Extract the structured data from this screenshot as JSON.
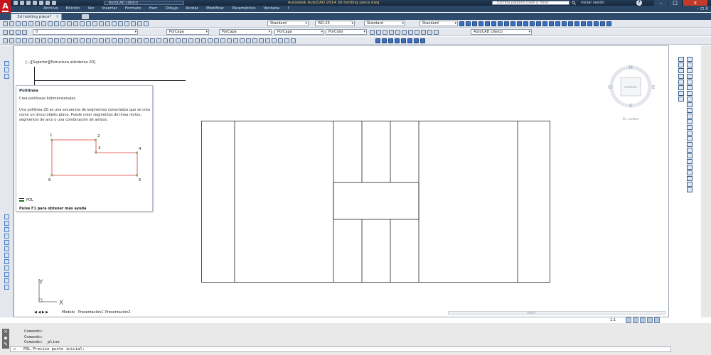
{
  "titlebar": {
    "workspace": "AutoCAD clásico",
    "window_title": "Autodesk AutoCAD 2014   3d holding piece.dwg",
    "search_placeholder": "Escriba palabra clave o frase",
    "login": "Iniciar sesión",
    "help": "?",
    "minimize": "–",
    "maximize": "□",
    "close": "x"
  },
  "menubar": {
    "items": [
      "Archivo",
      "Edición",
      "Ver",
      "Insertar",
      "Formato",
      "Herr",
      "Dibujo",
      "Acotar",
      "Modificar",
      "Paramétrico",
      "Ventana",
      "?"
    ],
    "doc_controls": "– ⊡ X"
  },
  "file_tab": {
    "label": "3d holding piece*",
    "close": "×"
  },
  "toolbars": {
    "text_style": "Standard",
    "dim_style": "ISO-25",
    "table_style": "Standard",
    "multileader_style": "Standard",
    "layer": "0",
    "color": "PorCapa",
    "linetype": "PorCapa",
    "lineweight": "PorCapa",
    "plotstyle": "PorColor",
    "workspace": "AutoCAD clásico"
  },
  "viewport_label": "[−][Superior][Estructura alámbrica 2D]",
  "tooltip": {
    "title": "Polilínea",
    "subtitle": "Crea polilíneas bidimensionales",
    "description": "Una polilínea 2D es una secuencia de segmentos conectados que se crea como un único objeto plano. Puede crear segmentos de línea rectos, segmentos de arco o una combinación de ambos.",
    "points": [
      "1",
      "2",
      "3",
      "4",
      "5",
      "6"
    ],
    "command": "POL",
    "help": "Pulse F1 para obtener más ayuda"
  },
  "viewcube": {
    "north": "N",
    "south": "S",
    "east": "E",
    "west": "O",
    "face": "SUPERIOR",
    "ucs": "Sin nombre"
  },
  "ucs": {
    "x": "X",
    "y": "Y"
  },
  "layout_tabs": {
    "nav": "◀ ◀ ▶ ▶",
    "model": "Modelo",
    "layout1": "Presentación1",
    "layout2": "Presentación2"
  },
  "status": {
    "scale": "1:1"
  },
  "command": {
    "history": [
      "Comando:",
      "Comando:",
      "Comando: _pline"
    ],
    "prompt": "POL Precise punto inicial:",
    "prompt_icon": "⊃"
  },
  "colors": {
    "polyline": "#e53935",
    "vertex": "#00a000",
    "accent": "#c8141b"
  }
}
